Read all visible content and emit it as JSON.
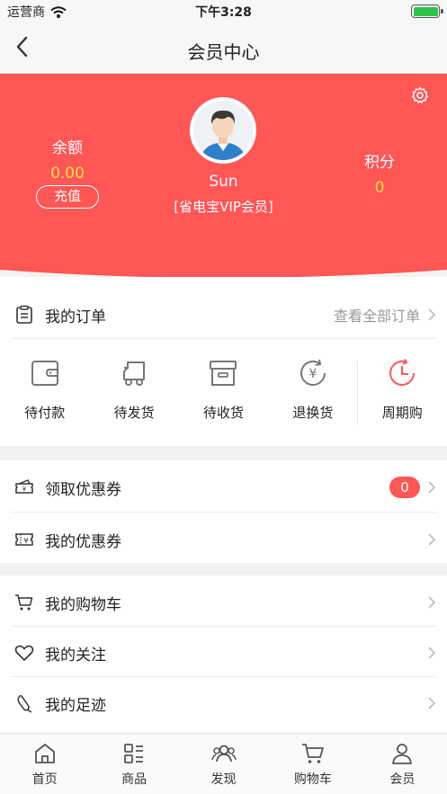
{
  "status_bar": {
    "carrier": "运营商",
    "time": "下午3:28"
  },
  "nav": {
    "title": "会员中心"
  },
  "colors": {
    "brand_red": "#ff5656",
    "accent_yellow": "#ffe14a"
  },
  "profile": {
    "balance_label": "余额",
    "balance_value": "0.00",
    "recharge_label": "充值",
    "username": "Sun",
    "member_level": "[省电宝VIP会员]",
    "points_label": "积分",
    "points_value": "0"
  },
  "orders": {
    "title": "我的订单",
    "view_all": "查看全部订单",
    "items": [
      {
        "label": "待付款",
        "icon": "wallet-icon"
      },
      {
        "label": "待发货",
        "icon": "delivery-truck-icon"
      },
      {
        "label": "待收货",
        "icon": "box-icon"
      },
      {
        "label": "退换货",
        "icon": "refund-icon"
      },
      {
        "label": "周期购",
        "icon": "clock-cycle-icon"
      }
    ]
  },
  "coupons": {
    "get_label": "领取优惠券",
    "get_count": "0",
    "mine_label": "我的优惠券"
  },
  "lists": {
    "cart_label": "我的购物车",
    "follow_label": "我的关注",
    "history_label": "我的足迹"
  },
  "tabbar": {
    "items": [
      {
        "label": "首页",
        "icon": "home-icon"
      },
      {
        "label": "商品",
        "icon": "products-icon"
      },
      {
        "label": "发现",
        "icon": "discover-icon"
      },
      {
        "label": "购物车",
        "icon": "cart-icon"
      },
      {
        "label": "会员",
        "icon": "member-icon"
      }
    ]
  }
}
